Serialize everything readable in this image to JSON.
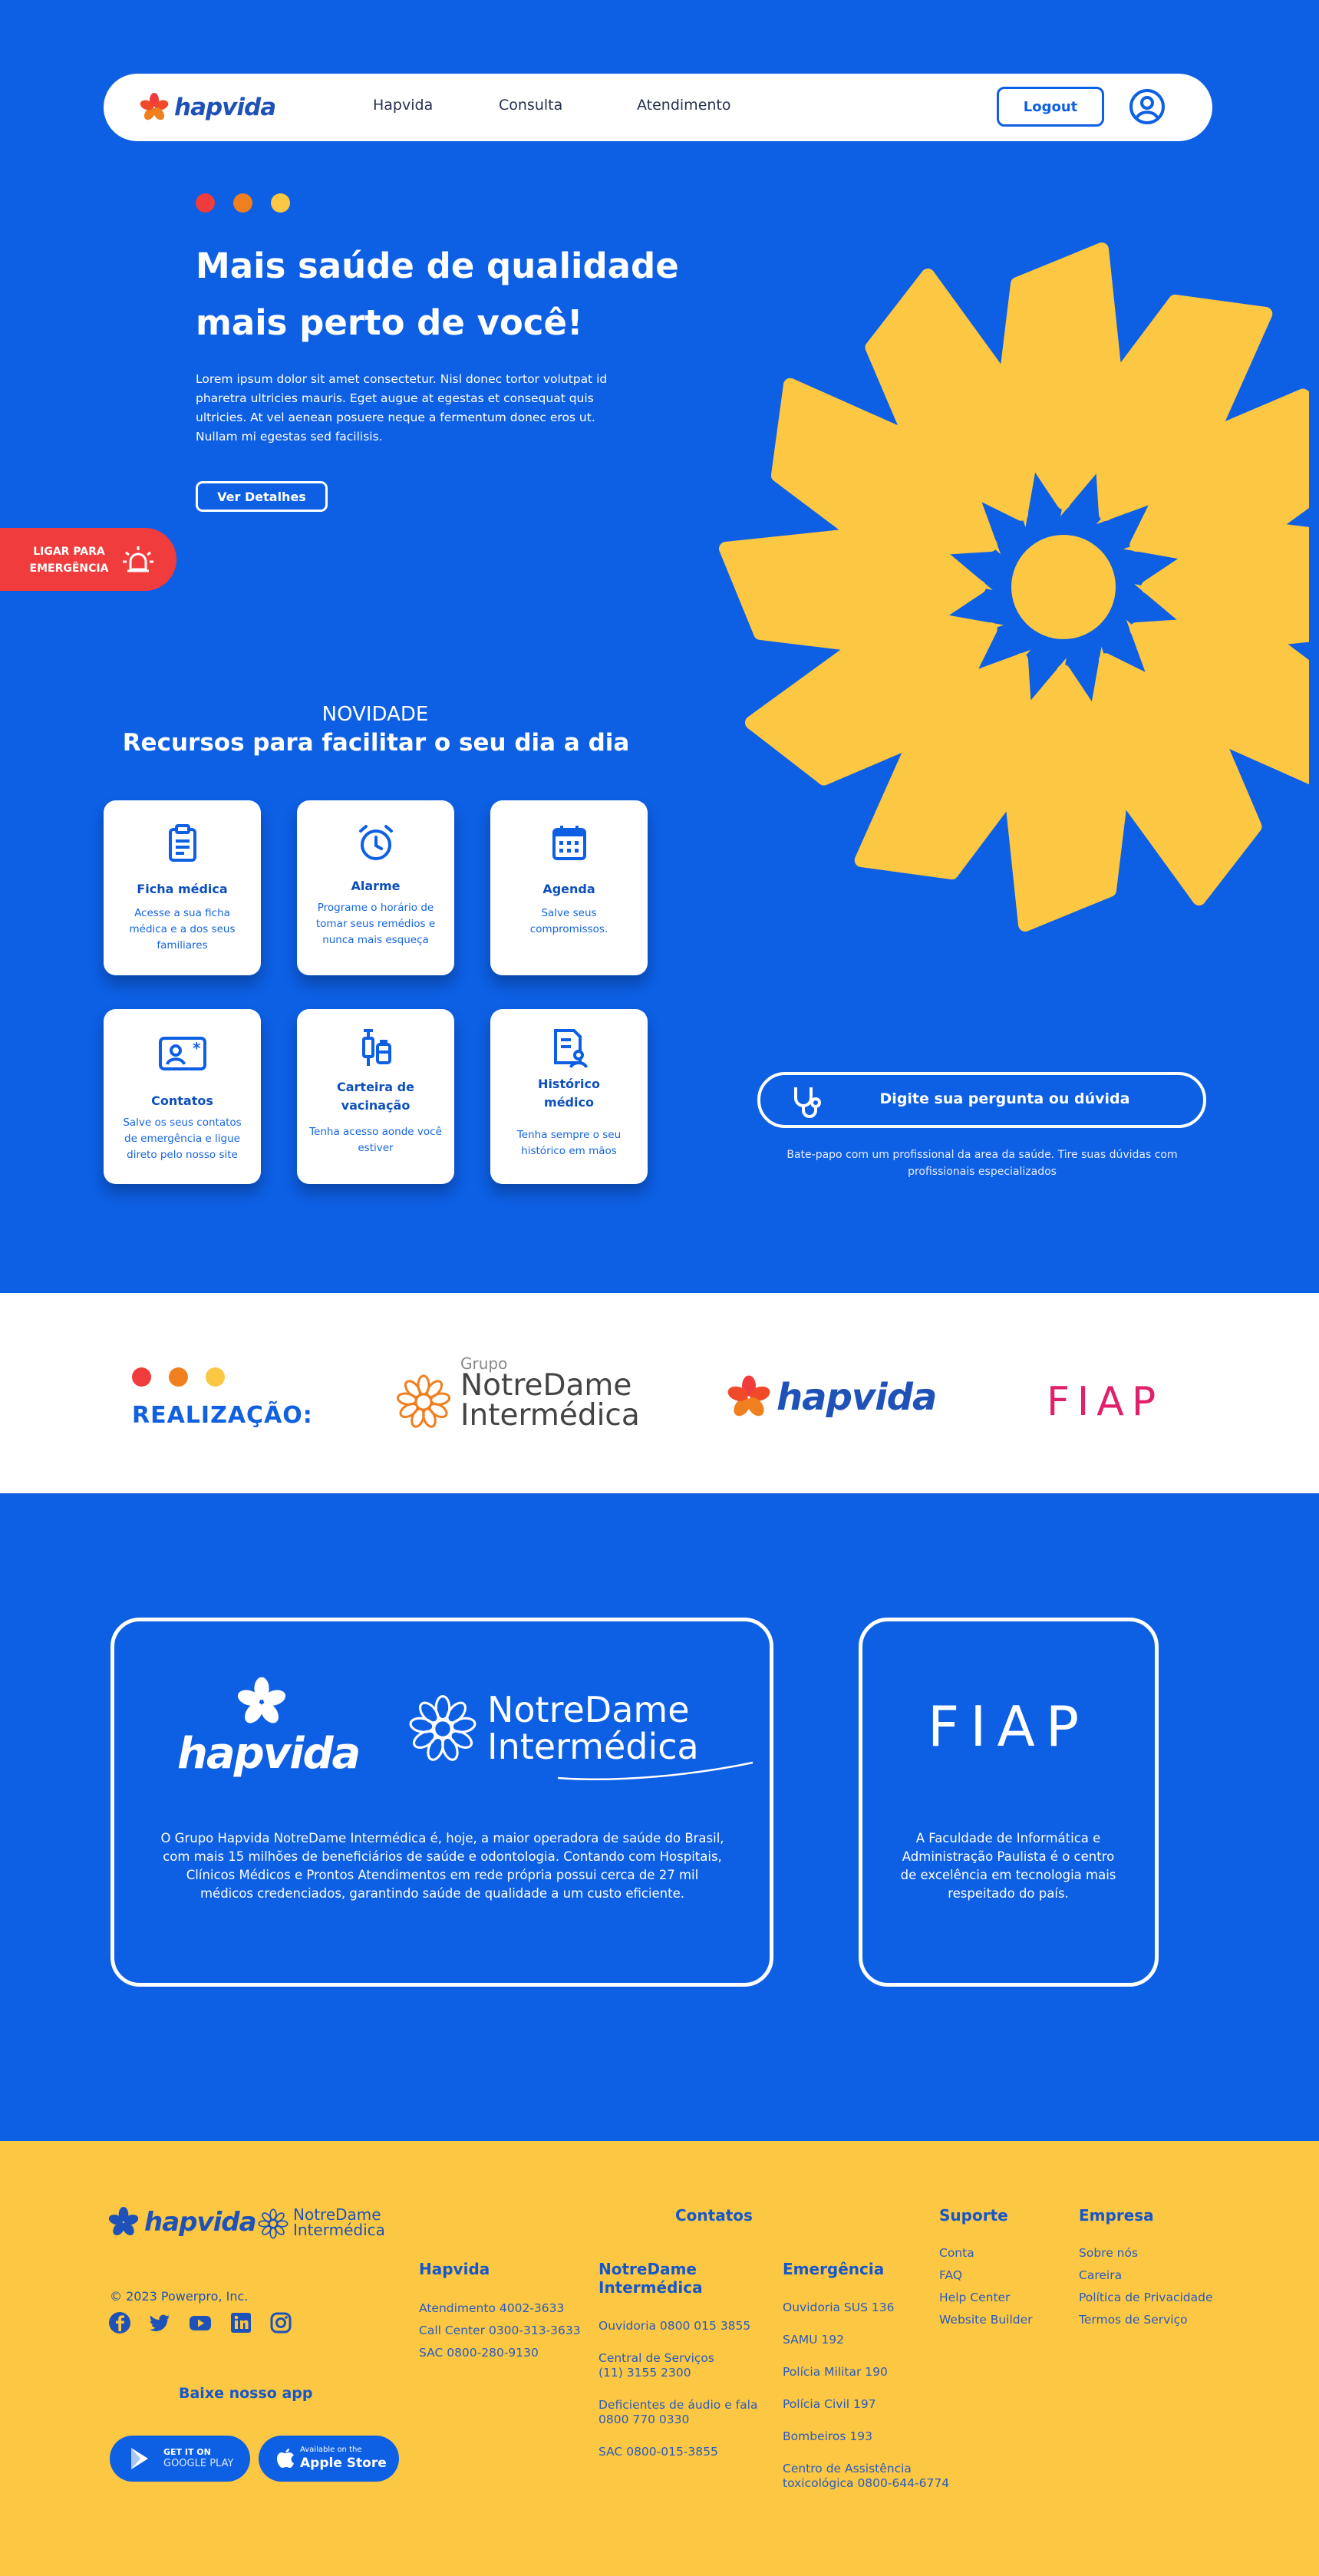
{
  "colors": {
    "blue": "#0d5fe4",
    "yellow": "#fcc742",
    "red": "#f03c3c",
    "orange": "#f07f20",
    "white": "#ffffff"
  },
  "nav": {
    "logo": "hapvida",
    "links": [
      "Hapvida",
      "Consulta",
      "Atendimento"
    ],
    "logout": "Logout",
    "user_icon": "user-circle-icon"
  },
  "hero": {
    "title_line1": "Mais saúde de qualidade",
    "title_line2": "mais perto de você!",
    "text": "Lorem ipsum dolor sit amet consectetur. Nisl donec tortor volutpat id pharetra ultricies mauris. Eget augue at egestas et consequat quis ultricies. At vel aenean posuere neque a fermentum donec eros ut. Nullam mi egestas sed facilisis.",
    "button": "Ver Detalhes"
  },
  "emergency": {
    "label_line1": "LIGAR PARA",
    "label_line2": "EMERGÊNCIA",
    "icon": "siren-icon"
  },
  "features": {
    "kicker": "NOVIDADE",
    "title": "Recursos para facilitar o seu dia a dia",
    "cards": [
      {
        "title": "Ficha médica",
        "desc": "Acesse a sua ficha médica e a dos seus familiares",
        "icon": "clipboard-icon"
      },
      {
        "title": "Alarme",
        "desc": "Programe o horário de tomar seus remédios e nunca mais esqueça",
        "icon": "alarm-clock-icon"
      },
      {
        "title": "Agenda",
        "desc": "Salve seus compromissos.",
        "icon": "calendar-icon"
      },
      {
        "title": "Contatos",
        "desc": "Salve os seus contatos de emergência e ligue direto pelo nosso site",
        "icon": "contact-card-icon"
      },
      {
        "title": "Carteira de vacinação",
        "desc": "Tenha acesso aonde você estiver",
        "icon": "vaccine-icon"
      },
      {
        "title": "Histórico médico",
        "desc": "Tenha sempre o seu histórico em mãos",
        "icon": "medical-history-icon"
      }
    ]
  },
  "ask": {
    "placeholder": "Digite sua pergunta ou dúvida",
    "note": "Bate-papo com um profissional da area da saúde. Tire suas dúvidas com profissionais especializados",
    "icon": "stethoscope-icon"
  },
  "partners": {
    "label": "REALIZAÇÃO:",
    "notredame_small": "Grupo",
    "notredame_line1": "NotreDame",
    "notredame_line2": "Intermédica",
    "hapvida": "hapvida",
    "fiap": "FIAP"
  },
  "about": {
    "hapvida_logo": "hapvida",
    "notredame_line1": "NotreDame",
    "notredame_line2": "Intermédica",
    "group_text": "O Grupo Hapvida NotreDame Intermédica é, hoje, a maior operadora de saúde do Brasil, com mais 15 milhões de beneficiários de saúde e odontologia. Contando com Hospitais, Clínicos Médicos e Prontos Atendimentos em rede própria possui cerca de 27 mil médicos credenciados, garantindo saúde de qualidade a um custo eficiente.",
    "fiap_logo": "FIAP",
    "fiap_text": "A Faculdade de Informática e Administração Paulista é o centro de excelência em tecnologia mais respeitado do país."
  },
  "footer": {
    "logo_hapvida": "hapvida",
    "logo_nd_line1": "NotreDame",
    "logo_nd_line2": "Intermédica",
    "copyright": "© 2023 Powerpro, Inc.",
    "social_icons": [
      "facebook-icon",
      "twitter-icon",
      "youtube-icon",
      "linkedin-icon",
      "instagram-icon"
    ],
    "app_title": "Baixe nosso app",
    "google_small": "GET IT ON",
    "google_big": "GOOGLE PLAY",
    "apple_small": "Available on the",
    "apple_big": "Apple Store",
    "contatos_title": "Contatos",
    "hapvida_col": {
      "title": "Hapvida",
      "items": [
        "Atendimento 4002-3633",
        "Call Center 0300-313-3633",
        "SAC 0800-280-9130"
      ]
    },
    "notredame_col": {
      "title_line1": "NotreDame",
      "title_line2": "Intermédica",
      "items": [
        {
          "l1": "Ouvidoria 0800 015 3855",
          "l2": ""
        },
        {
          "l1": "Central de Serviços",
          "l2": "(11) 3155 2300"
        },
        {
          "l1": "Deficientes de áudio e fala",
          "l2": "0800 770 0330"
        },
        {
          "l1": "SAC 0800-015-3855",
          "l2": ""
        }
      ]
    },
    "emergencia_col": {
      "title": "Emergência",
      "items": [
        "Ouvidoria SUS 136",
        "SAMU 192",
        "Polícia Militar 190",
        "Polícia Civil 197",
        "Bombeiros 193"
      ],
      "last_l1": "Centro de Assistência",
      "last_l2": "toxicológica 0800-644-6774"
    },
    "suporte_col": {
      "title": "Suporte",
      "items": [
        "Conta",
        "FAQ",
        "Help Center",
        "Website Builder"
      ]
    },
    "empresa_col": {
      "title": "Empresa",
      "items": [
        "Sobre nós",
        "Careira",
        "Política de Privacidade",
        "Termos de Serviço"
      ]
    }
  }
}
